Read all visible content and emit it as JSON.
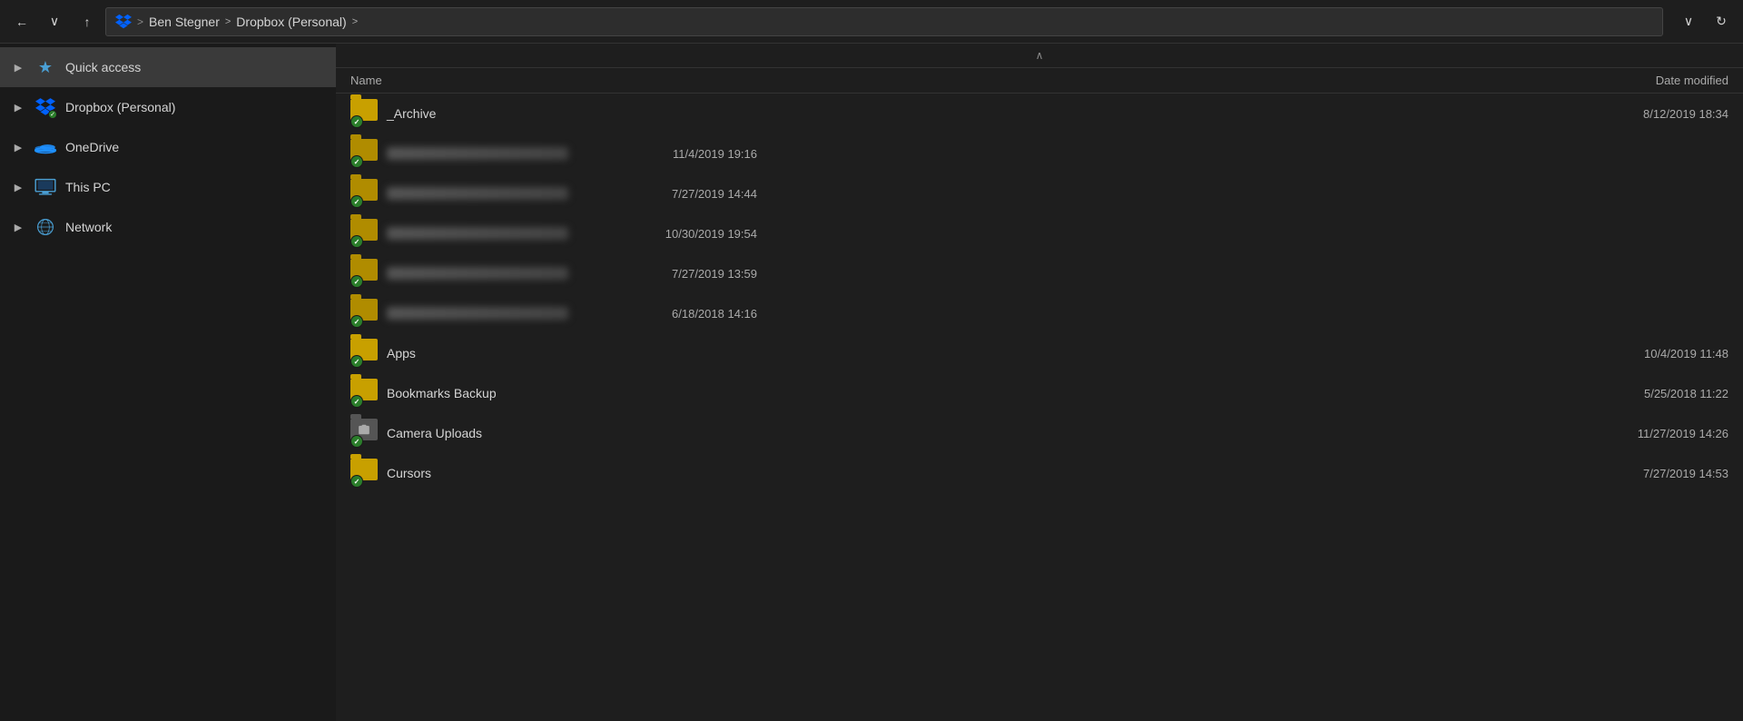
{
  "titlebar": {
    "back_label": "←",
    "down_label": "∨",
    "up_label": "↑",
    "address": {
      "breadcrumbs": [
        "Ben Stegner",
        "Dropbox (Personal)"
      ],
      "separator": ">",
      "chevron_right": ">"
    },
    "refresh_label": "↻",
    "dropdown_label": "∨"
  },
  "sidebar": {
    "items": [
      {
        "id": "quick-access",
        "label": "Quick access",
        "icon": "star",
        "active": true
      },
      {
        "id": "dropbox",
        "label": "Dropbox (Personal)",
        "icon": "dropbox",
        "active": false
      },
      {
        "id": "onedrive",
        "label": "OneDrive",
        "icon": "onedrive",
        "active": false
      },
      {
        "id": "this-pc",
        "label": "This PC",
        "icon": "pc",
        "active": false
      },
      {
        "id": "network",
        "label": "Network",
        "icon": "network",
        "active": false
      }
    ]
  },
  "columns": {
    "name": "Name",
    "date_modified": "Date modified"
  },
  "sort_chevron": "∧",
  "files": [
    {
      "id": "archive",
      "name": "_Archive",
      "date": "8/12/2019 18:34",
      "type": "folder",
      "blurred": false,
      "camera": false
    },
    {
      "id": "folder2",
      "name": "",
      "date": "11/4/2019 19:16",
      "type": "folder",
      "blurred": true,
      "camera": false
    },
    {
      "id": "folder3",
      "name": "",
      "date": "7/27/2019 14:44",
      "type": "folder",
      "blurred": true,
      "camera": false
    },
    {
      "id": "folder4",
      "name": "",
      "date": "10/30/2019 19:54",
      "type": "folder",
      "blurred": true,
      "camera": false
    },
    {
      "id": "folder5",
      "name": "",
      "date": "7/27/2019 13:59",
      "type": "folder",
      "blurred": true,
      "camera": false
    },
    {
      "id": "folder6",
      "name": "",
      "date": "6/18/2018 14:16",
      "type": "folder",
      "blurred": true,
      "camera": false
    },
    {
      "id": "apps",
      "name": "Apps",
      "date": "10/4/2019 11:48",
      "type": "folder",
      "blurred": false,
      "camera": false
    },
    {
      "id": "bookmarks-backup",
      "name": "Bookmarks Backup",
      "date": "5/25/2018 11:22",
      "type": "folder",
      "blurred": false,
      "camera": false
    },
    {
      "id": "camera-uploads",
      "name": "Camera Uploads",
      "date": "11/27/2019 14:26",
      "type": "camera-folder",
      "blurred": false,
      "camera": true
    },
    {
      "id": "cursors",
      "name": "Cursors",
      "date": "7/27/2019 14:53",
      "type": "folder",
      "blurred": false,
      "camera": false
    }
  ]
}
